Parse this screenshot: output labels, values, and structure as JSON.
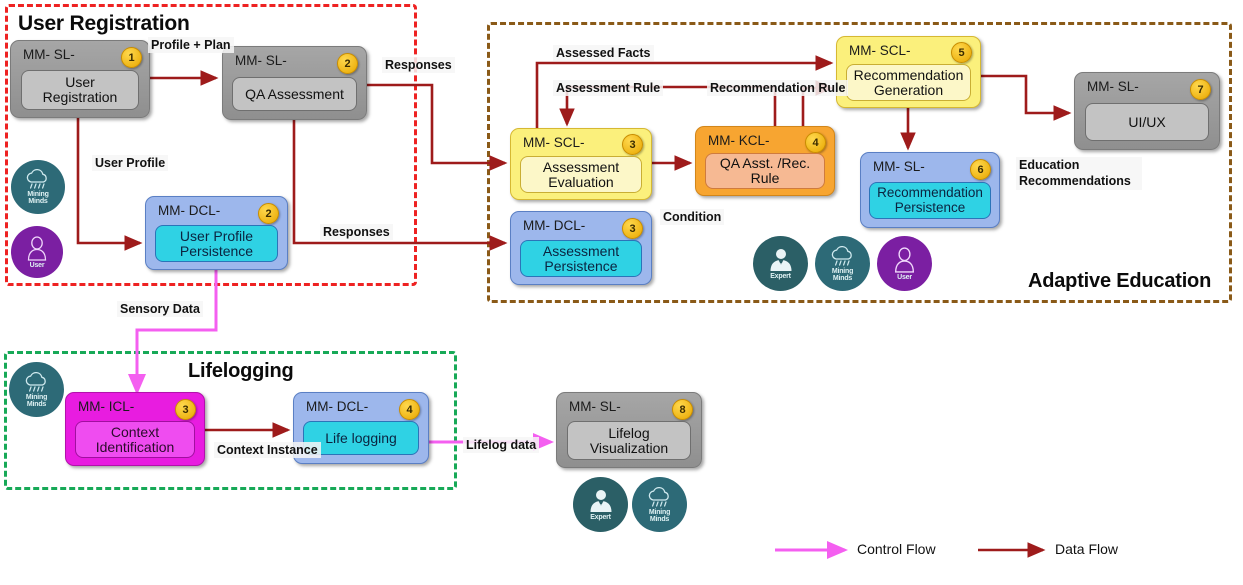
{
  "colors": {
    "data_flow": "#9e1b1b",
    "control_flow": "#f45ff0",
    "group_user_registration_border": "#ee2222",
    "group_adaptive_education_border": "#8a5a18",
    "group_lifelogging_border": "#17a957",
    "badge": "#e8a700"
  },
  "groups": {
    "user_registration": {
      "title": "User Registration"
    },
    "adaptive_education": {
      "title": "Adaptive Education"
    },
    "lifelogging": {
      "title": "Lifelogging"
    }
  },
  "components": [
    {
      "id": "user-registration",
      "header": "MM- SL-",
      "label": "User\nRegistration",
      "badge": "1"
    },
    {
      "id": "qa-assessment",
      "header": "MM- SL-",
      "label": "QA Assessment",
      "badge": "2"
    },
    {
      "id": "user-profile-persistence",
      "header": "MM- DCL-",
      "label": "User Profile\nPersistence",
      "badge": "2"
    },
    {
      "id": "assessment-evaluation",
      "header": "MM- SCL-",
      "label": "Assessment\nEvaluation",
      "badge": "3"
    },
    {
      "id": "assessment-persistence",
      "header": "MM- DCL-",
      "label": "Assessment\nPersistence",
      "badge": "3"
    },
    {
      "id": "qa-asst-rec-rule",
      "header": "MM- KCL-",
      "label": "QA Asst. /Rec.\nRule",
      "badge": "4"
    },
    {
      "id": "recommendation-generation",
      "header": "MM- SCL-",
      "label": "Recommendation\nGeneration",
      "badge": "5"
    },
    {
      "id": "recommendation-persistence",
      "header": "MM- SL-",
      "label": "Recommendation\nPersistence",
      "badge": "6"
    },
    {
      "id": "ui-ux",
      "header": "MM- SL-",
      "label": "UI/UX",
      "badge": "7"
    },
    {
      "id": "context-identification",
      "header": "MM- ICL-",
      "label": "Context\nIdentification",
      "badge": "3"
    },
    {
      "id": "life-logging",
      "header": "MM- DCL-",
      "label": "Life logging",
      "badge": "4"
    },
    {
      "id": "lifelog-visualization",
      "header": "MM- SL-",
      "label": "Lifelog\nVisualization",
      "badge": "8"
    }
  ],
  "edge_labels": {
    "profile_plan": "Profile + Plan",
    "responses_top": "Responses",
    "user_profile": "User Profile",
    "responses_bottom": "Responses",
    "assessed_facts": "Assessed Facts",
    "assessment_rule": "Assessment Rule",
    "recommendation_rule": "Recommendation Rule",
    "condition": "Condition",
    "education_recommendations": "Education\nRecommendations",
    "sensory_data": "Sensory Data",
    "context_instance": "Context Instance",
    "lifelog_data": "Lifelog data"
  },
  "roles": {
    "mining_minds": "Mining\nMinds",
    "user": "User",
    "expert": "Expert"
  },
  "legend": {
    "control_flow": "Control  Flow",
    "data_flow": "Data Flow"
  }
}
